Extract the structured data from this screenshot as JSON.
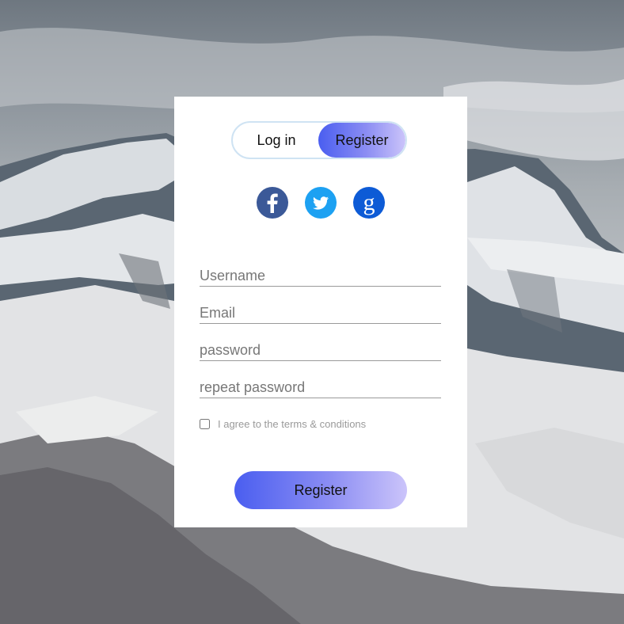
{
  "background": {
    "icon": "snowy-mountains-landscape",
    "sky_color": "#6e7780",
    "snow_color": "#e6e8ea"
  },
  "form": {
    "toggle": {
      "login_label": "Log in",
      "register_label": "Register",
      "active": "register"
    },
    "social": [
      {
        "icon": "facebook-icon",
        "color": "#3b5998"
      },
      {
        "icon": "twitter-icon",
        "color": "#1da1f2"
      },
      {
        "icon": "google-icon",
        "color": "#0d5bd6"
      }
    ],
    "fields": {
      "username_placeholder": "Username",
      "email_placeholder": "Email",
      "password_placeholder": "password",
      "repeat_password_placeholder": "repeat password"
    },
    "agree_label": "I agree to the terms & conditions",
    "submit_label": "Register",
    "accent_gradient": [
      "#4a5ef0",
      "#cbc4fa"
    ]
  }
}
